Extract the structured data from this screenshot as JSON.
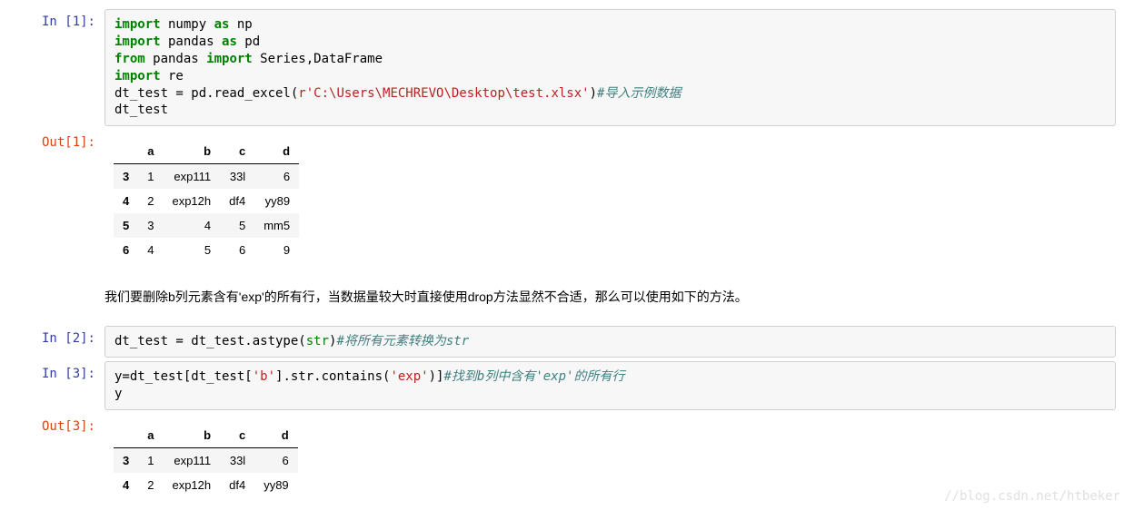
{
  "cells": {
    "in1": {
      "prompt": "In [1]:",
      "tokens": [
        {
          "t": "import",
          "c": "kw-green"
        },
        {
          "t": " numpy "
        },
        {
          "t": "as",
          "c": "kw-green"
        },
        {
          "t": " np\n"
        },
        {
          "t": "import",
          "c": "kw-green"
        },
        {
          "t": " pandas "
        },
        {
          "t": "as",
          "c": "kw-green"
        },
        {
          "t": " pd\n"
        },
        {
          "t": "from",
          "c": "kw-green"
        },
        {
          "t": " pandas "
        },
        {
          "t": "import",
          "c": "kw-green"
        },
        {
          "t": " Series,DataFrame\n"
        },
        {
          "t": "import",
          "c": "kw-green"
        },
        {
          "t": " re\n"
        },
        {
          "t": "dt_test = pd.read_excel("
        },
        {
          "t": "r'C:\\Users\\MECHREVO\\Desktop\\test.xlsx'",
          "c": "str"
        },
        {
          "t": ")"
        },
        {
          "t": "#导入示例数据",
          "c": "comment"
        },
        {
          "t": "\n"
        },
        {
          "t": "dt_test"
        }
      ]
    },
    "out1": {
      "prompt": "Out[1]:",
      "headers": [
        "",
        "a",
        "b",
        "c",
        "d"
      ],
      "rows": [
        {
          "idx": "3",
          "cells": [
            "1",
            "exp111",
            "33l",
            "6"
          ]
        },
        {
          "idx": "4",
          "cells": [
            "2",
            "exp12h",
            "df4",
            "yy89"
          ]
        },
        {
          "idx": "5",
          "cells": [
            "3",
            "4",
            "5",
            "mm5"
          ]
        },
        {
          "idx": "6",
          "cells": [
            "4",
            "5",
            "6",
            "9"
          ]
        }
      ]
    },
    "para": "我们要删除b列元素含有'exp'的所有行，当数据量较大时直接使用drop方法显然不合适，那么可以使用如下的方法。",
    "in2": {
      "prompt": "In [2]:",
      "tokens": [
        {
          "t": "dt_test = dt_test.astype("
        },
        {
          "t": "str",
          "c": "builtin"
        },
        {
          "t": ")"
        },
        {
          "t": "#将所有元素转换为str",
          "c": "comment"
        }
      ]
    },
    "in3": {
      "prompt": "In [3]:",
      "tokens": [
        {
          "t": "y=dt_test[dt_test["
        },
        {
          "t": "'b'",
          "c": "str"
        },
        {
          "t": "].str.contains("
        },
        {
          "t": "'exp'",
          "c": "str"
        },
        {
          "t": ")]"
        },
        {
          "t": "#找到b列中含有'exp'的所有行",
          "c": "comment"
        },
        {
          "t": "\n"
        },
        {
          "t": "y"
        }
      ]
    },
    "out3": {
      "prompt": "Out[3]:",
      "headers": [
        "",
        "a",
        "b",
        "c",
        "d"
      ],
      "rows": [
        {
          "idx": "3",
          "cells": [
            "1",
            "exp111",
            "33l",
            "6"
          ]
        },
        {
          "idx": "4",
          "cells": [
            "2",
            "exp12h",
            "df4",
            "yy89"
          ]
        }
      ]
    }
  },
  "watermark": "//blog.csdn.net/htbeker"
}
